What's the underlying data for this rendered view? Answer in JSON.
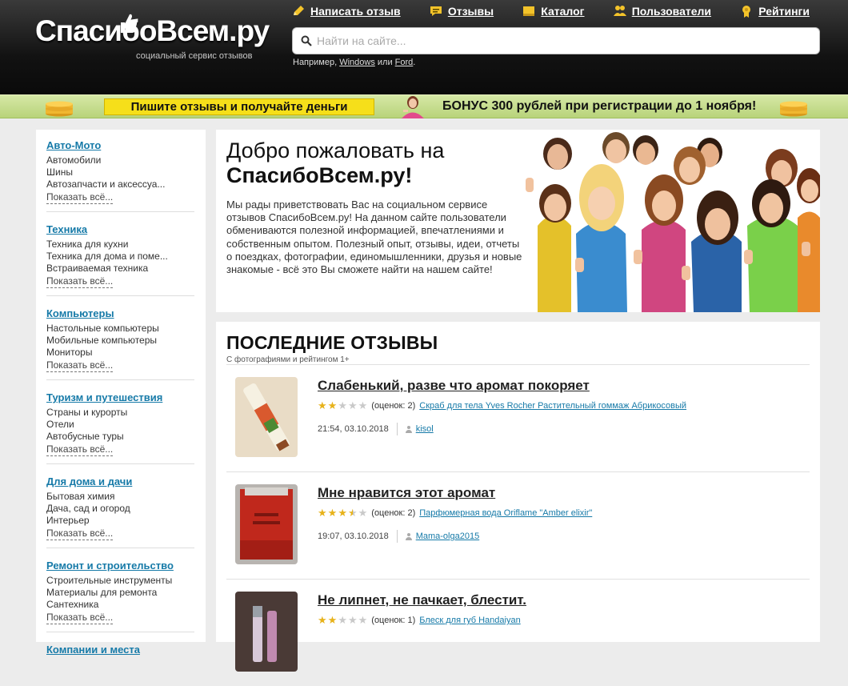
{
  "header": {
    "logo_text": "СпасибоВсем.ру",
    "logo_subtitle": "социальный сервис отзывов",
    "nav": [
      {
        "label": "Написать отзыв",
        "icon": "pencil-icon"
      },
      {
        "label": "Отзывы",
        "icon": "speech-bubble-icon"
      },
      {
        "label": "Каталог",
        "icon": "folder-icon"
      },
      {
        "label": "Пользователи",
        "icon": "users-icon"
      },
      {
        "label": "Рейтинги",
        "icon": "medal-icon"
      }
    ],
    "search": {
      "placeholder": "Найти на сайте...",
      "hint_prefix": "Например,",
      "hint_example_1": "Windows",
      "hint_or": "или",
      "hint_example_2": "Ford"
    }
  },
  "promo": {
    "left_text": "Пишите отзывы и получайте деньги",
    "bonus_text": "БОНУС 300 рублей при регистрации до 1 ноября!"
  },
  "sidebar": {
    "show_all_label": "Показать всё...",
    "categories": [
      {
        "title": "Авто-Мото",
        "items": [
          "Автомобили",
          "Шины",
          "Автозапчасти и аксессуа..."
        ]
      },
      {
        "title": "Техника",
        "items": [
          "Техника для кухни",
          "Техника для дома и поме...",
          "Встраиваемая техника"
        ]
      },
      {
        "title": "Компьютеры",
        "items": [
          "Настольные компьютеры",
          "Мобильные компьютеры",
          "Мониторы"
        ]
      },
      {
        "title": "Туризм и путешествия",
        "items": [
          "Страны и курорты",
          "Отели",
          "Автобусные туры"
        ]
      },
      {
        "title": "Для дома и дачи",
        "items": [
          "Бытовая химия",
          "Дача, сад и огород",
          "Интерьер"
        ]
      },
      {
        "title": "Ремонт и строительство",
        "items": [
          "Строительные инструменты",
          "Материалы для ремонта",
          "Сантехника"
        ]
      },
      {
        "title": "Компании и места",
        "items": []
      }
    ]
  },
  "welcome": {
    "title_line1": "Добро пожаловать на",
    "title_line2": "СпасибоВсем.ру!",
    "text": "Мы рады приветствовать Вас на социальном сервисе отзывов СпасибоВсем.ру! На данном сайте пользователи обмениваются полезной информацией, впечатлениями и собственным опытом. Полезный опыт, отзывы, идеи, отчеты о поездках, фотографии, единомышленники, друзья и новые знакомые - всё это Вы сможете найти на нашем сайте!"
  },
  "reviews": {
    "title": "ПОСЛЕДНИЕ ОТЗЫВЫ",
    "subtitle": "С фотографиями и рейтингом 1+",
    "items": [
      {
        "title": "Слабенький, разве что аромат покоряет",
        "rating": 2,
        "votes": "(оценок: 2)",
        "product": "Скраб для тела Yves Rocher Растительный гоммаж Абрикосовый",
        "datetime": "21:54, 03.10.2018",
        "user": "kisol"
      },
      {
        "title": "Мне нравится этот аромат",
        "rating": 3.5,
        "votes": "(оценок: 2)",
        "product": "Парфюмерная вода Oriflame \"Amber elixir\"",
        "datetime": "19:07, 03.10.2018",
        "user": "Mama-olga2015"
      },
      {
        "title": "Не липнет, не пачкает, блестит.",
        "rating": 2,
        "votes": "(оценок: 1)",
        "product": "Блеск для губ Handaiyan",
        "datetime": "",
        "user": ""
      }
    ]
  },
  "colors": {
    "link_blue": "#167aa8",
    "header_dark": "#121212",
    "promo_yellow": "#f6df1a",
    "promo_green": "#c4db8a",
    "star_gold": "#e7b21a"
  }
}
